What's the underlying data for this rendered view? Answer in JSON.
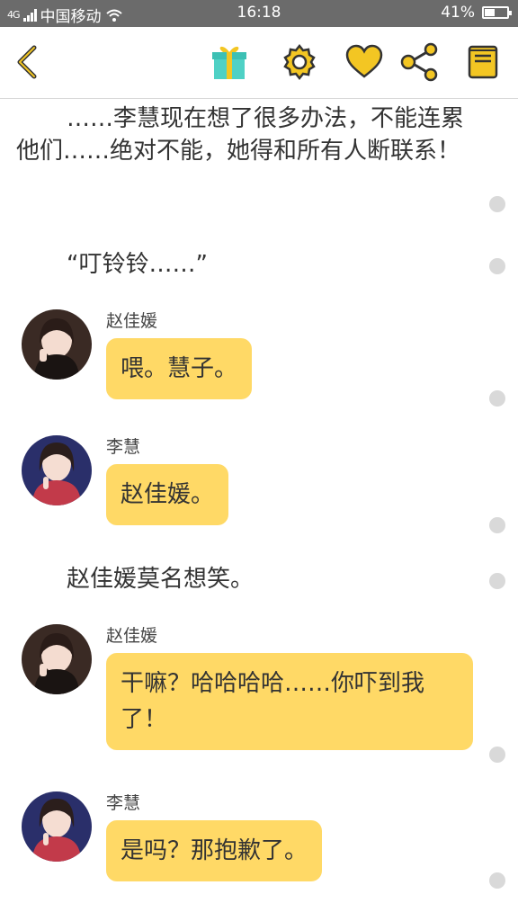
{
  "status_bar": {
    "carrier": "中国移动",
    "network": "4G",
    "time": "16:18",
    "battery": "41%",
    "battery_level": 0.41
  },
  "toolbar": {
    "icons": [
      "back-icon",
      "gift-icon",
      "settings-icon",
      "favorite-icon",
      "share-icon",
      "menu-icon"
    ],
    "accent": "#f3c623",
    "icon_stroke": "#333333"
  },
  "story": [
    {
      "kind": "narration",
      "text": "……李慧现在想了很多办法，不能连累他们……绝对不能，她得和所有人断联系！"
    },
    {
      "kind": "narration",
      "text": "“叮铃铃……”"
    },
    {
      "kind": "message",
      "speaker": "赵佳媛",
      "text": "喂。慧子。"
    },
    {
      "kind": "message",
      "speaker": "李慧",
      "text": "赵佳媛。"
    },
    {
      "kind": "narration",
      "text": "赵佳媛莫名想笑。"
    },
    {
      "kind": "message",
      "speaker": "赵佳媛",
      "text": "干嘛？哈哈哈哈……你吓到我了！"
    },
    {
      "kind": "message",
      "speaker": "李慧",
      "text": "是吗？那抱歉了。"
    }
  ],
  "colors": {
    "bubble": "#ffd966",
    "dot": "#d9d9d9",
    "status_bar": "#6b6b6b"
  }
}
